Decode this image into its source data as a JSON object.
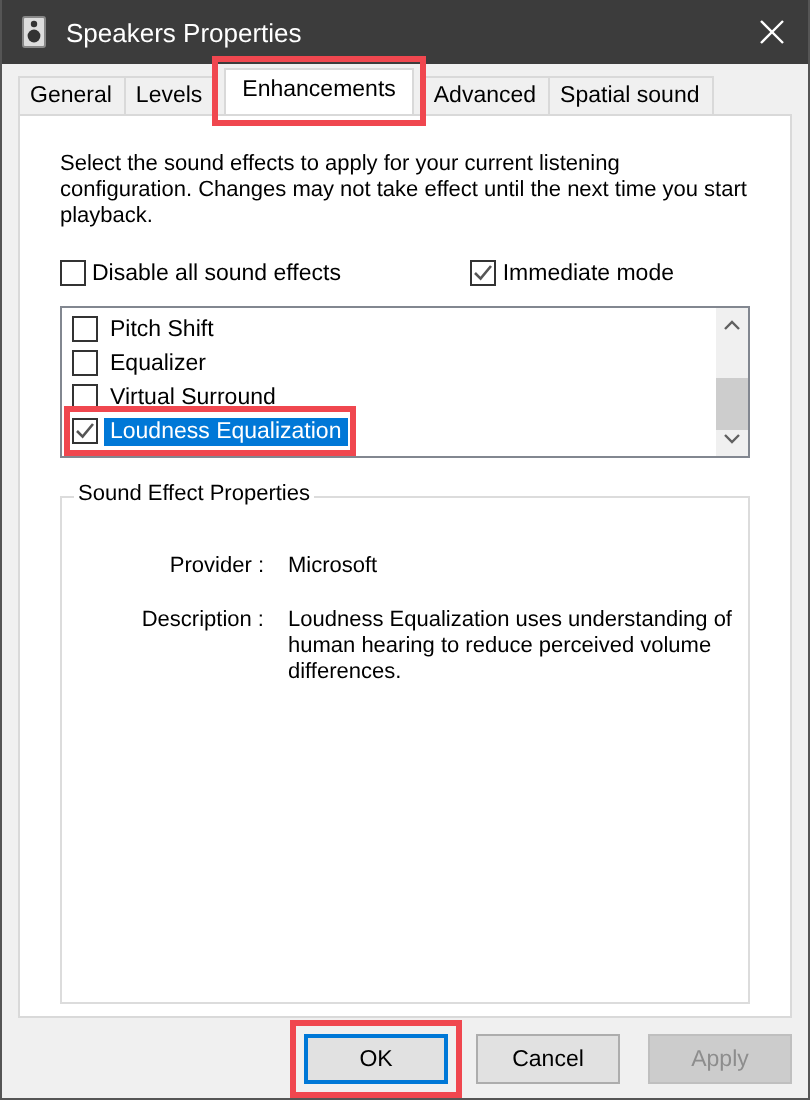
{
  "window": {
    "title": "Speakers Properties"
  },
  "tabs": [
    {
      "label": "General",
      "selected": false,
      "highlighted": false
    },
    {
      "label": "Levels",
      "selected": false,
      "highlighted": false
    },
    {
      "label": "Enhancements",
      "selected": true,
      "highlighted": true
    },
    {
      "label": "Advanced",
      "selected": false,
      "highlighted": false
    },
    {
      "label": "Spatial sound",
      "selected": false,
      "highlighted": false
    }
  ],
  "intro": "Select the sound effects to apply for your current listening configuration. Changes may not take effect until the next time you start playback.",
  "options": [
    {
      "label": "Disable all sound effects",
      "checked": false
    },
    {
      "label": "Immediate mode",
      "checked": true
    }
  ],
  "effects": [
    {
      "label": "Pitch Shift",
      "checked": false,
      "selected": false,
      "highlighted": false
    },
    {
      "label": "Equalizer",
      "checked": false,
      "selected": false,
      "highlighted": false
    },
    {
      "label": "Virtual Surround",
      "checked": false,
      "selected": false,
      "highlighted": false
    },
    {
      "label": "Loudness Equalization",
      "checked": true,
      "selected": true,
      "highlighted": true
    }
  ],
  "properties": {
    "title": "Sound Effect Properties",
    "rows": [
      {
        "label": "Provider :",
        "value": "Microsoft"
      },
      {
        "label": "Description :",
        "value": "Loudness Equalization uses understanding of human hearing to reduce perceived volume differences."
      }
    ]
  },
  "buttons": [
    {
      "label": "OK",
      "default": true,
      "disabled": false,
      "highlighted": true
    },
    {
      "label": "Cancel",
      "default": false,
      "disabled": false,
      "highlighted": false
    },
    {
      "label": "Apply",
      "default": false,
      "disabled": true,
      "highlighted": false
    }
  ]
}
